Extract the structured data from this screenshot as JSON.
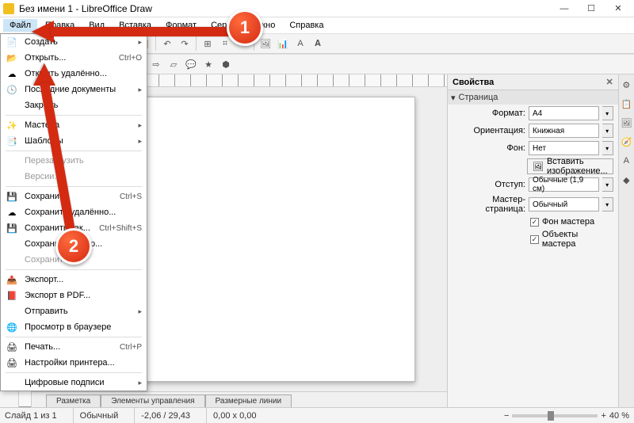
{
  "title": "Без имени 1 - LibreOffice Draw",
  "menubar": [
    "Файл",
    "Правка",
    "Вид",
    "Вставка",
    "Формат",
    "Сервис",
    "Окно",
    "Справка"
  ],
  "filemenu": {
    "create": "Создать",
    "open": "Открыть...",
    "open_sc": "Ctrl+O",
    "open_remote": "Открыть удалённо...",
    "recent": "Последние документы",
    "close": "Закрыть",
    "wizards": "Мастера",
    "templates": "Шаблоны",
    "reload": "Перезагрузить",
    "versions": "Версии...",
    "save": "Сохранить",
    "save_sc": "Ctrl+S",
    "save_remote": "Сохранить удалённо...",
    "save_as": "Сохранить как...",
    "save_as_sc": "Ctrl+Shift+S",
    "save_copy": "Сохранить копию...",
    "save_all": "Сохранить всё",
    "export": "Экспорт...",
    "export_pdf": "Экспорт в PDF...",
    "send": "Отправить",
    "preview": "Просмотр в браузере",
    "print": "Печать...",
    "print_sc": "Ctrl+P",
    "printer": "Настройки принтера...",
    "signatures": "Цифровые подписи"
  },
  "tabs": [
    "Разметка",
    "Элементы управления",
    "Размерные линии"
  ],
  "props": {
    "title": "Свойства",
    "section": "Страница",
    "format_lbl": "Формат:",
    "format_val": "A4",
    "orient_lbl": "Ориентация:",
    "orient_val": "Книжная",
    "bg_lbl": "Фон:",
    "bg_val": "Нет",
    "insert_img": "Вставить изображение...",
    "margin_lbl": "Отступ:",
    "margin_val": "Обычные (1,9 см)",
    "master_lbl": "Мастер-страница:",
    "master_val": "Обычный",
    "chk_bg": "Фон мастера",
    "chk_obj": "Объекты мастера"
  },
  "status": {
    "slide": "Слайд 1 из 1",
    "style": "Обычный",
    "coords": "-2,06 / 29,43",
    "size": "0,00 x 0,00",
    "zoom": "40 %"
  },
  "callouts": {
    "one": "1",
    "two": "2"
  }
}
